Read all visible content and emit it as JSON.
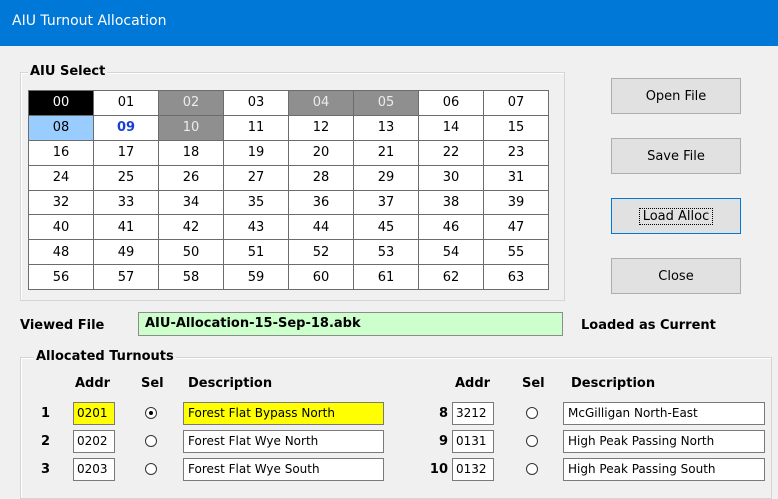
{
  "window": {
    "title": "AIU Turnout Allocation"
  },
  "aiu_select": {
    "label": "AIU Select",
    "cells": [
      {
        "v": "00",
        "s": "black"
      },
      {
        "v": "01",
        "s": ""
      },
      {
        "v": "02",
        "s": "gray"
      },
      {
        "v": "03",
        "s": ""
      },
      {
        "v": "04",
        "s": "gray"
      },
      {
        "v": "05",
        "s": "gray"
      },
      {
        "v": "06",
        "s": ""
      },
      {
        "v": "07",
        "s": ""
      },
      {
        "v": "08",
        "s": "blue"
      },
      {
        "v": "09",
        "s": "bold"
      },
      {
        "v": "10",
        "s": "gray"
      },
      {
        "v": "11",
        "s": ""
      },
      {
        "v": "12",
        "s": ""
      },
      {
        "v": "13",
        "s": ""
      },
      {
        "v": "14",
        "s": ""
      },
      {
        "v": "15",
        "s": ""
      },
      {
        "v": "16",
        "s": ""
      },
      {
        "v": "17",
        "s": ""
      },
      {
        "v": "18",
        "s": ""
      },
      {
        "v": "19",
        "s": ""
      },
      {
        "v": "20",
        "s": ""
      },
      {
        "v": "21",
        "s": ""
      },
      {
        "v": "22",
        "s": ""
      },
      {
        "v": "23",
        "s": ""
      },
      {
        "v": "24",
        "s": ""
      },
      {
        "v": "25",
        "s": ""
      },
      {
        "v": "26",
        "s": ""
      },
      {
        "v": "27",
        "s": ""
      },
      {
        "v": "28",
        "s": ""
      },
      {
        "v": "29",
        "s": ""
      },
      {
        "v": "30",
        "s": ""
      },
      {
        "v": "31",
        "s": ""
      },
      {
        "v": "32",
        "s": ""
      },
      {
        "v": "33",
        "s": ""
      },
      {
        "v": "34",
        "s": ""
      },
      {
        "v": "35",
        "s": ""
      },
      {
        "v": "36",
        "s": ""
      },
      {
        "v": "37",
        "s": ""
      },
      {
        "v": "38",
        "s": ""
      },
      {
        "v": "39",
        "s": ""
      },
      {
        "v": "40",
        "s": ""
      },
      {
        "v": "41",
        "s": ""
      },
      {
        "v": "42",
        "s": ""
      },
      {
        "v": "43",
        "s": ""
      },
      {
        "v": "44",
        "s": ""
      },
      {
        "v": "45",
        "s": ""
      },
      {
        "v": "46",
        "s": ""
      },
      {
        "v": "47",
        "s": ""
      },
      {
        "v": "48",
        "s": ""
      },
      {
        "v": "49",
        "s": ""
      },
      {
        "v": "50",
        "s": ""
      },
      {
        "v": "51",
        "s": ""
      },
      {
        "v": "52",
        "s": ""
      },
      {
        "v": "53",
        "s": ""
      },
      {
        "v": "54",
        "s": ""
      },
      {
        "v": "55",
        "s": ""
      },
      {
        "v": "56",
        "s": ""
      },
      {
        "v": "57",
        "s": ""
      },
      {
        "v": "58",
        "s": ""
      },
      {
        "v": "59",
        "s": ""
      },
      {
        "v": "60",
        "s": ""
      },
      {
        "v": "61",
        "s": ""
      },
      {
        "v": "62",
        "s": ""
      },
      {
        "v": "63",
        "s": ""
      }
    ]
  },
  "buttons": {
    "open_file": "Open File",
    "save_file": "Save File",
    "load_alloc": "Load Alloc",
    "close": "Close"
  },
  "viewed_file": {
    "label": "Viewed File",
    "value": "AIU-Allocation-15-Sep-18.abk",
    "status": "Loaded as Current"
  },
  "allocated": {
    "label": "Allocated Turnouts",
    "headers": {
      "addr": "Addr",
      "sel": "Sel",
      "desc": "Description"
    },
    "left": [
      {
        "num": "1",
        "addr": "0201",
        "selected": true,
        "desc": "Forest Flat Bypass North",
        "hl": true
      },
      {
        "num": "2",
        "addr": "0202",
        "selected": false,
        "desc": "Forest Flat Wye North",
        "hl": false
      },
      {
        "num": "3",
        "addr": "0203",
        "selected": false,
        "desc": "Forest Flat Wye South",
        "hl": false
      }
    ],
    "right": [
      {
        "num": "8",
        "addr": "3212",
        "selected": false,
        "desc": "McGilligan North-East",
        "hl": false
      },
      {
        "num": "9",
        "addr": "0131",
        "selected": false,
        "desc": "High Peak Passing North",
        "hl": false
      },
      {
        "num": "10",
        "addr": "0132",
        "selected": false,
        "desc": "High Peak Passing South",
        "hl": false
      }
    ]
  },
  "colors": {
    "title_bar": "#0078d7",
    "viewed_file_bg": "#ccffcc",
    "highlight": "#ffff00",
    "selected_cell": "#000000",
    "used_cell": "#8f8f8f",
    "hover_cell": "#99ccff"
  }
}
